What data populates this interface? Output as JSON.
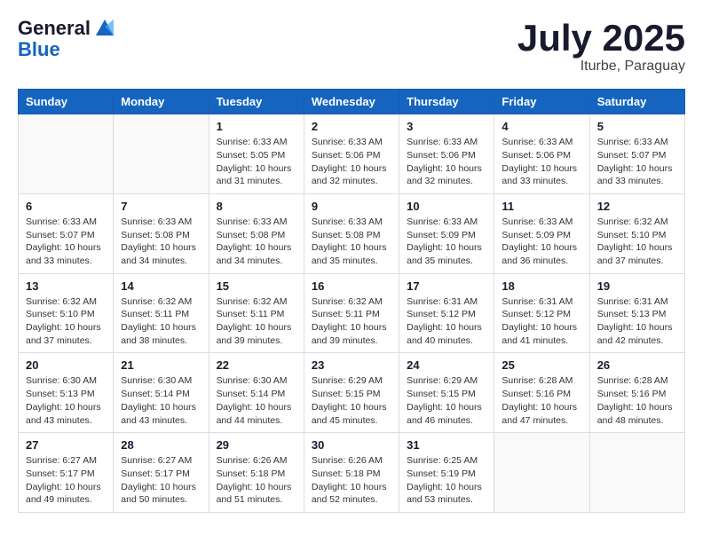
{
  "header": {
    "logo_general": "General",
    "logo_blue": "Blue",
    "title": "July 2025",
    "location": "Iturbe, Paraguay"
  },
  "days_of_week": [
    "Sunday",
    "Monday",
    "Tuesday",
    "Wednesday",
    "Thursday",
    "Friday",
    "Saturday"
  ],
  "weeks": [
    [
      {
        "day": "",
        "info": ""
      },
      {
        "day": "",
        "info": ""
      },
      {
        "day": "1",
        "info": "Sunrise: 6:33 AM\nSunset: 5:05 PM\nDaylight: 10 hours and 31 minutes."
      },
      {
        "day": "2",
        "info": "Sunrise: 6:33 AM\nSunset: 5:06 PM\nDaylight: 10 hours and 32 minutes."
      },
      {
        "day": "3",
        "info": "Sunrise: 6:33 AM\nSunset: 5:06 PM\nDaylight: 10 hours and 32 minutes."
      },
      {
        "day": "4",
        "info": "Sunrise: 6:33 AM\nSunset: 5:06 PM\nDaylight: 10 hours and 33 minutes."
      },
      {
        "day": "5",
        "info": "Sunrise: 6:33 AM\nSunset: 5:07 PM\nDaylight: 10 hours and 33 minutes."
      }
    ],
    [
      {
        "day": "6",
        "info": "Sunrise: 6:33 AM\nSunset: 5:07 PM\nDaylight: 10 hours and 33 minutes."
      },
      {
        "day": "7",
        "info": "Sunrise: 6:33 AM\nSunset: 5:08 PM\nDaylight: 10 hours and 34 minutes."
      },
      {
        "day": "8",
        "info": "Sunrise: 6:33 AM\nSunset: 5:08 PM\nDaylight: 10 hours and 34 minutes."
      },
      {
        "day": "9",
        "info": "Sunrise: 6:33 AM\nSunset: 5:08 PM\nDaylight: 10 hours and 35 minutes."
      },
      {
        "day": "10",
        "info": "Sunrise: 6:33 AM\nSunset: 5:09 PM\nDaylight: 10 hours and 35 minutes."
      },
      {
        "day": "11",
        "info": "Sunrise: 6:33 AM\nSunset: 5:09 PM\nDaylight: 10 hours and 36 minutes."
      },
      {
        "day": "12",
        "info": "Sunrise: 6:32 AM\nSunset: 5:10 PM\nDaylight: 10 hours and 37 minutes."
      }
    ],
    [
      {
        "day": "13",
        "info": "Sunrise: 6:32 AM\nSunset: 5:10 PM\nDaylight: 10 hours and 37 minutes."
      },
      {
        "day": "14",
        "info": "Sunrise: 6:32 AM\nSunset: 5:11 PM\nDaylight: 10 hours and 38 minutes."
      },
      {
        "day": "15",
        "info": "Sunrise: 6:32 AM\nSunset: 5:11 PM\nDaylight: 10 hours and 39 minutes."
      },
      {
        "day": "16",
        "info": "Sunrise: 6:32 AM\nSunset: 5:11 PM\nDaylight: 10 hours and 39 minutes."
      },
      {
        "day": "17",
        "info": "Sunrise: 6:31 AM\nSunset: 5:12 PM\nDaylight: 10 hours and 40 minutes."
      },
      {
        "day": "18",
        "info": "Sunrise: 6:31 AM\nSunset: 5:12 PM\nDaylight: 10 hours and 41 minutes."
      },
      {
        "day": "19",
        "info": "Sunrise: 6:31 AM\nSunset: 5:13 PM\nDaylight: 10 hours and 42 minutes."
      }
    ],
    [
      {
        "day": "20",
        "info": "Sunrise: 6:30 AM\nSunset: 5:13 PM\nDaylight: 10 hours and 43 minutes."
      },
      {
        "day": "21",
        "info": "Sunrise: 6:30 AM\nSunset: 5:14 PM\nDaylight: 10 hours and 43 minutes."
      },
      {
        "day": "22",
        "info": "Sunrise: 6:30 AM\nSunset: 5:14 PM\nDaylight: 10 hours and 44 minutes."
      },
      {
        "day": "23",
        "info": "Sunrise: 6:29 AM\nSunset: 5:15 PM\nDaylight: 10 hours and 45 minutes."
      },
      {
        "day": "24",
        "info": "Sunrise: 6:29 AM\nSunset: 5:15 PM\nDaylight: 10 hours and 46 minutes."
      },
      {
        "day": "25",
        "info": "Sunrise: 6:28 AM\nSunset: 5:16 PM\nDaylight: 10 hours and 47 minutes."
      },
      {
        "day": "26",
        "info": "Sunrise: 6:28 AM\nSunset: 5:16 PM\nDaylight: 10 hours and 48 minutes."
      }
    ],
    [
      {
        "day": "27",
        "info": "Sunrise: 6:27 AM\nSunset: 5:17 PM\nDaylight: 10 hours and 49 minutes."
      },
      {
        "day": "28",
        "info": "Sunrise: 6:27 AM\nSunset: 5:17 PM\nDaylight: 10 hours and 50 minutes."
      },
      {
        "day": "29",
        "info": "Sunrise: 6:26 AM\nSunset: 5:18 PM\nDaylight: 10 hours and 51 minutes."
      },
      {
        "day": "30",
        "info": "Sunrise: 6:26 AM\nSunset: 5:18 PM\nDaylight: 10 hours and 52 minutes."
      },
      {
        "day": "31",
        "info": "Sunrise: 6:25 AM\nSunset: 5:19 PM\nDaylight: 10 hours and 53 minutes."
      },
      {
        "day": "",
        "info": ""
      },
      {
        "day": "",
        "info": ""
      }
    ]
  ]
}
